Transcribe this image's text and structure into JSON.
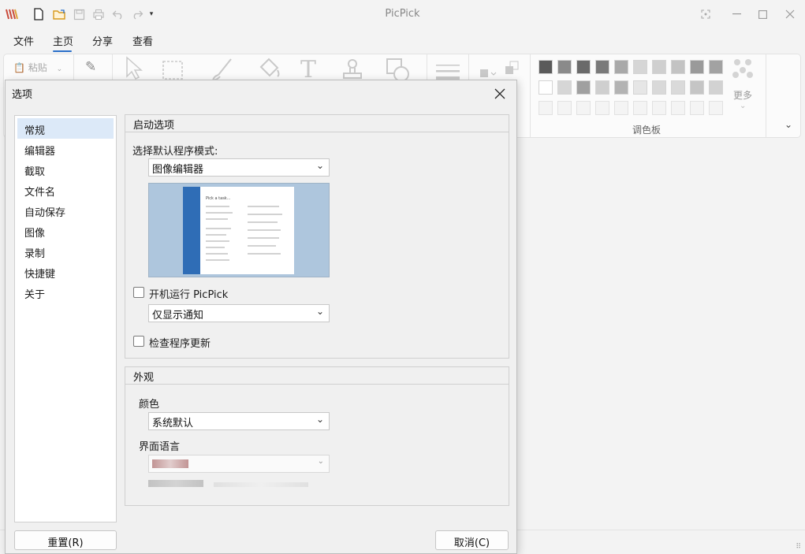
{
  "app": {
    "title": "PicPick",
    "logo_icon": "picpick-logo-icon",
    "quick_access": [
      "new-file-icon",
      "open-folder-icon",
      "save-icon",
      "print-icon",
      "undo-icon",
      "redo-icon",
      "customize-dropdown-icon"
    ]
  },
  "menu": {
    "items": [
      "文件",
      "主页",
      "分享",
      "查看"
    ],
    "active": "主页",
    "accent": "#2a6fc9"
  },
  "ribbon": {
    "paste_label": "粘贴",
    "more_label": "更多",
    "palette_label": "调色板",
    "palette_colors_row1": [
      "#5a5a5a",
      "#8a8a8a",
      "#6a6a6a",
      "#7a7a7a",
      "#a9a9a9",
      "#d6d6d6",
      "#cfcfcf",
      "#c3c3c3",
      "#9a9a9a",
      "#a2a2a2"
    ],
    "palette_colors_row2": [
      "#ffffff",
      "#d6d6d6",
      "#a0a0a0",
      "#cfcfcf",
      "#b3b3b3",
      "#e6e6e6",
      "#d9d9d9",
      "#dadada",
      "#c5c5c5",
      "#d2d2d2"
    ]
  },
  "dialog": {
    "title": "选项",
    "nav": [
      "常规",
      "编辑器",
      "截取",
      "文件名",
      "自动保存",
      "图像",
      "录制",
      "快捷键",
      "关于"
    ],
    "nav_active": "常规",
    "startup": {
      "title": "启动选项",
      "default_mode_label": "选择默认程序模式:",
      "default_mode_value": "图像编辑器",
      "preview_caption": "Pick a task...",
      "run_at_startup_label": "开机运行 PicPick",
      "run_at_startup_checked": false,
      "notify_value": "仅显示通知",
      "check_updates_label": "检查程序更新",
      "check_updates_checked": false
    },
    "appearance": {
      "title": "外观",
      "color_label": "颜色",
      "color_value": "系统默认",
      "language_label": "界面语言"
    },
    "buttons": {
      "reset": "重置(R)",
      "cancel": "取消(C)"
    }
  }
}
